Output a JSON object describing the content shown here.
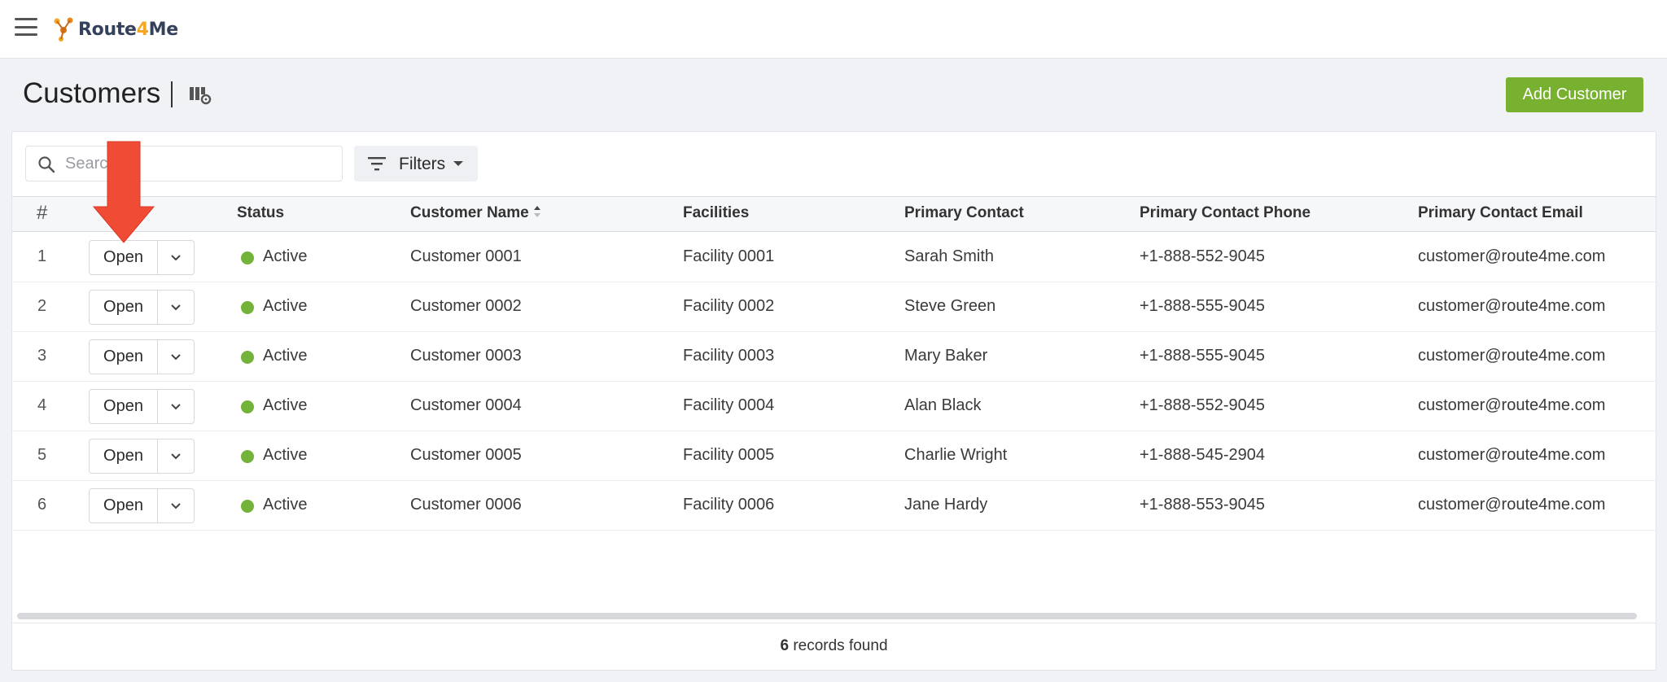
{
  "app": {
    "logo_text_a": "Route",
    "logo_text_b": "4",
    "logo_text_c": "Me"
  },
  "header": {
    "title": "Customers",
    "add_button_label": "Add Customer",
    "add_button_color": "#78b030"
  },
  "toolbar": {
    "search_placeholder": "Search",
    "filters_label": "Filters"
  },
  "table": {
    "columns": [
      "#",
      "Status",
      "Customer Name",
      "Facilities",
      "Primary Contact",
      "Primary Contact Phone",
      "Primary Contact Email"
    ],
    "sorted_column": "Customer Name",
    "open_label": "Open",
    "rows": [
      {
        "num": "1",
        "status": "Active",
        "name": "Customer 0001",
        "facility": "Facility 0001",
        "contact": "Sarah Smith",
        "phone": "+1-888-552-9045",
        "email": "customer@route4me.com"
      },
      {
        "num": "2",
        "status": "Active",
        "name": "Customer 0002",
        "facility": "Facility 0002",
        "contact": "Steve Green",
        "phone": "+1-888-555-9045",
        "email": "customer@route4me.com"
      },
      {
        "num": "3",
        "status": "Active",
        "name": "Customer 0003",
        "facility": "Facility 0003",
        "contact": "Mary Baker",
        "phone": "+1-888-555-9045",
        "email": "customer@route4me.com"
      },
      {
        "num": "4",
        "status": "Active",
        "name": "Customer 0004",
        "facility": "Facility 0004",
        "contact": "Alan Black",
        "phone": "+1-888-552-9045",
        "email": "customer@route4me.com"
      },
      {
        "num": "5",
        "status": "Active",
        "name": "Customer 0005",
        "facility": "Facility 0005",
        "contact": "Charlie Wright",
        "phone": "+1-888-545-2904",
        "email": "customer@route4me.com"
      },
      {
        "num": "6",
        "status": "Active",
        "name": "Customer 0006",
        "facility": "Facility 0006",
        "contact": "Jane Hardy",
        "phone": "+1-888-553-9045",
        "email": "customer@route4me.com"
      }
    ],
    "status_color": "#74b33a"
  },
  "footer": {
    "count": "6",
    "count_suffix": " records found"
  },
  "icons": {
    "menu": "hamburger-menu-icon",
    "columns": "columns-settings-icon",
    "search": "search-icon",
    "filter": "filter-icon",
    "annotation": "red-arrow-annotation"
  }
}
